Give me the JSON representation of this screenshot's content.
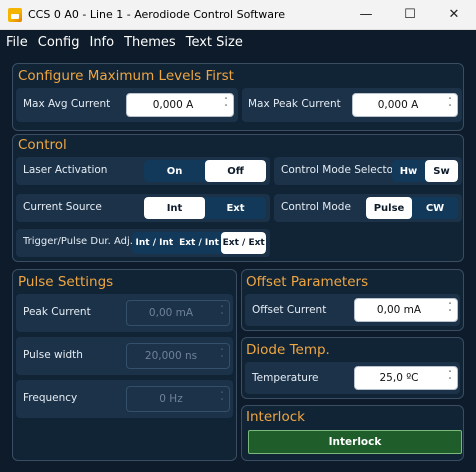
{
  "window": {
    "title": "CCS 0 A0 - Line 1 - Aerodiode Control Software"
  },
  "menu": [
    "File",
    "Config",
    "Info",
    "Themes",
    "Text Size"
  ],
  "configure": {
    "title": "Configure Maximum Levels First",
    "max_avg_label": "Max Avg Current",
    "max_avg_value": "0,000 A",
    "max_peak_label": "Max Peak Current",
    "max_peak_value": "0,000 A"
  },
  "control": {
    "title": "Control",
    "laser_label": "Laser Activation",
    "laser_options": [
      "On",
      "Off"
    ],
    "laser_selected": "Off",
    "mode_selector_label": "Control Mode Selector",
    "mode_selector_options": [
      "Hw",
      "Sw"
    ],
    "mode_selector_selected": "Sw",
    "source_label": "Current Source",
    "source_options": [
      "Int",
      "Ext"
    ],
    "source_selected": "Int",
    "mode_label": "Control Mode",
    "mode_options": [
      "Pulse",
      "CW"
    ],
    "mode_selected": "Pulse",
    "trigger_label": "Trigger/Pulse Dur. Adj.",
    "trigger_options": [
      "Int / Int",
      "Ext / Int",
      "Ext / Ext"
    ],
    "trigger_selected": "Ext / Ext"
  },
  "pulse": {
    "title": "Pulse Settings",
    "peak_label": "Peak Current",
    "peak_value": "0,00 mA",
    "width_label": "Pulse width",
    "width_value": "20,000 ns",
    "freq_label": "Frequency",
    "freq_value": "0 Hz"
  },
  "offset": {
    "title": "Offset Parameters",
    "current_label": "Offset Current",
    "current_value": "0,00 mA"
  },
  "diode": {
    "title": "Diode Temp.",
    "temp_label": "Temperature",
    "temp_value": "25,0 ºC"
  },
  "interlock": {
    "title": "Interlock",
    "button_label": "Interlock"
  },
  "colors": {
    "background": "#0d1b2a",
    "panel": "#112436",
    "section_title": "#f0a640",
    "interlock_green": "#1f5e2a"
  }
}
